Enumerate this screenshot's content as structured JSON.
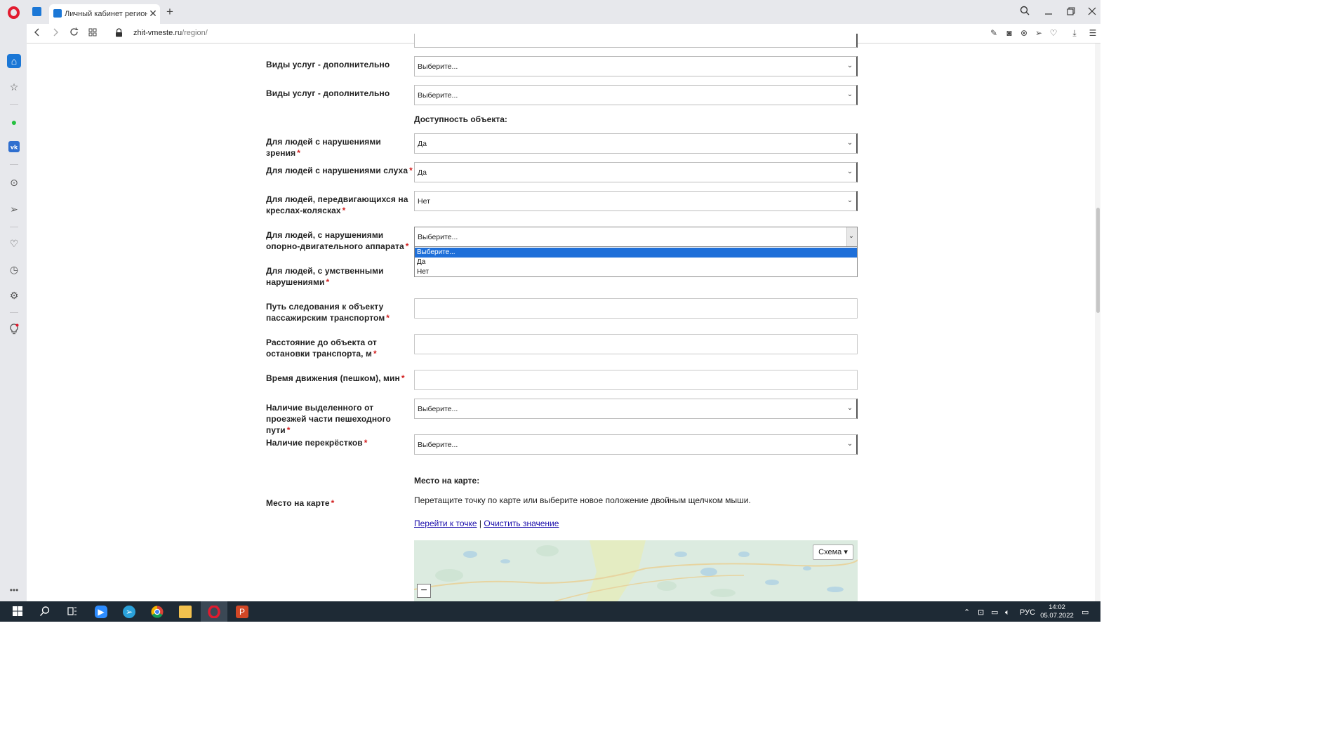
{
  "browser": {
    "tab_title": "Личный кабинет регионал",
    "url_domain": "zhit-vmeste.ru",
    "url_path": "/region/",
    "new_tab": "+",
    "tab_close": "✕"
  },
  "form": {
    "extra_services_1": {
      "label": "Виды услуг - дополнительно",
      "value": "Выберите..."
    },
    "extra_services_2": {
      "label": "Виды услуг - дополнительно",
      "value": "Выберите..."
    },
    "accessibility_title": "Доступность объекта:",
    "vision": {
      "label": "Для людей с нарушениями зрения",
      "value": "Да"
    },
    "hearing": {
      "label": "Для людей с нарушениями слуха",
      "value": "Да"
    },
    "wheelchair": {
      "label": "Для людей, передвигающихся на креслах-колясках",
      "value": "Нет"
    },
    "musculoskeletal": {
      "label": "Для людей, с нарушениями опорно-двигательного аппарата",
      "value": "Выберите...",
      "options": [
        "Выберите...",
        "Да",
        "Нет"
      ],
      "selected_index": 0
    },
    "mental": {
      "label": "Для людей, с умственными нарушениями"
    },
    "transport_route": {
      "label": "Путь следования к объекту пассажирским транспортом",
      "value": ""
    },
    "stop_distance": {
      "label": "Расстояние до объекта от остановки транспорта, м",
      "value": ""
    },
    "walk_time": {
      "label": "Время движения (пешком), мин",
      "value": ""
    },
    "pedestrian_path": {
      "label": "Наличие выделенного от проезжей части пешеходного пути",
      "value": "Выберите..."
    },
    "crossings": {
      "label": "Наличие перекрёстков",
      "value": "Выберите..."
    },
    "map_section_title": "Место на карте:",
    "map_label": "Место на карте",
    "map_hint": "Перетащите точку по карте или выберите новое положение двойным щелчком мыши.",
    "goto_point": "Перейти к точке",
    "link_separator": "|",
    "clear_value": "Очистить значение",
    "map_type_button": "Схема ▾",
    "zoom_out": "−",
    "required_mark": "*"
  },
  "taskbar": {
    "language": "РУС",
    "time": "14:02",
    "date": "05.07.2022"
  },
  "colors": {
    "accent": "#1e6fd9",
    "required": "#d21f1f",
    "link": "#1a0dab",
    "opera_red": "#e21b2f"
  }
}
